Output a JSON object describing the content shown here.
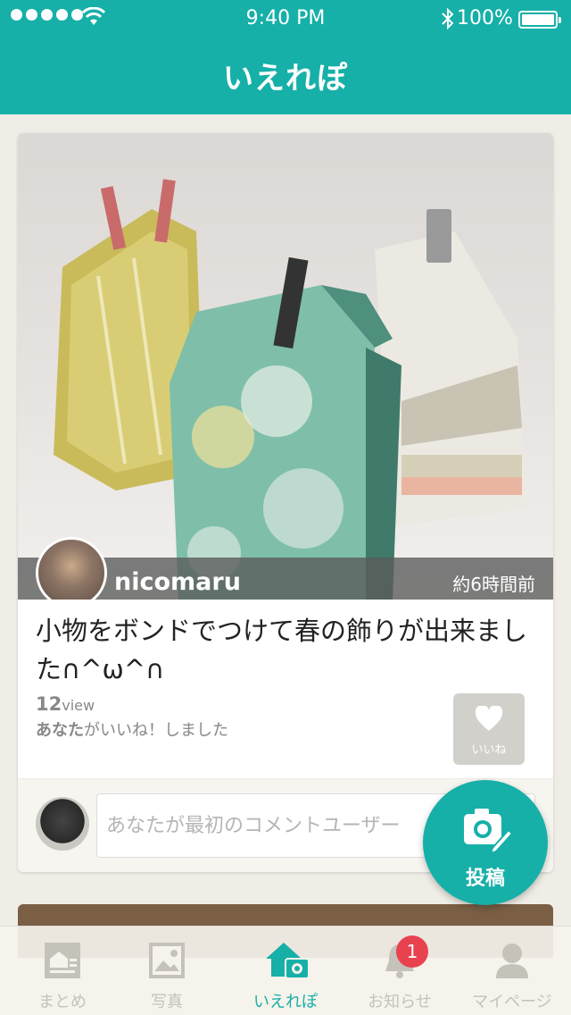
{
  "status_bar": {
    "time": "9:40 PM",
    "battery": "100%",
    "icons": [
      "signal-dots-icon",
      "wifi-icon",
      "bluetooth-icon",
      "battery-icon"
    ]
  },
  "header": {
    "title": "いえれぽ"
  },
  "post": {
    "username": "nicomaru",
    "posted": "約6時間前",
    "text": "小物をボンドでつけて春の飾りが出来ました∩^ω^∩",
    "views_count": "12",
    "views_unit": "view",
    "liked_who": "あなた",
    "liked_rest": "がいいね！しました",
    "like_label": "いいね",
    "comment_placeholder": "あなたが最初のコメントユーザー"
  },
  "fab": {
    "label": "投稿",
    "icon": "camera-pen-icon"
  },
  "tabbar": {
    "tabs": [
      {
        "label": "まとめ",
        "icon": "matome-icon"
      },
      {
        "label": "写真",
        "icon": "photo-icon"
      },
      {
        "label": "いえれぽ",
        "icon": "house-camera-icon"
      },
      {
        "label": "お知らせ",
        "icon": "bell-icon"
      },
      {
        "label": "マイページ",
        "icon": "person-icon"
      }
    ],
    "active": "いえれぽ",
    "notification_badge": "1"
  },
  "colors": {
    "brand": "#16b0a8",
    "background": "#efede6",
    "badge": "#e8424f",
    "tab_inactive": "#c5c2ba"
  }
}
